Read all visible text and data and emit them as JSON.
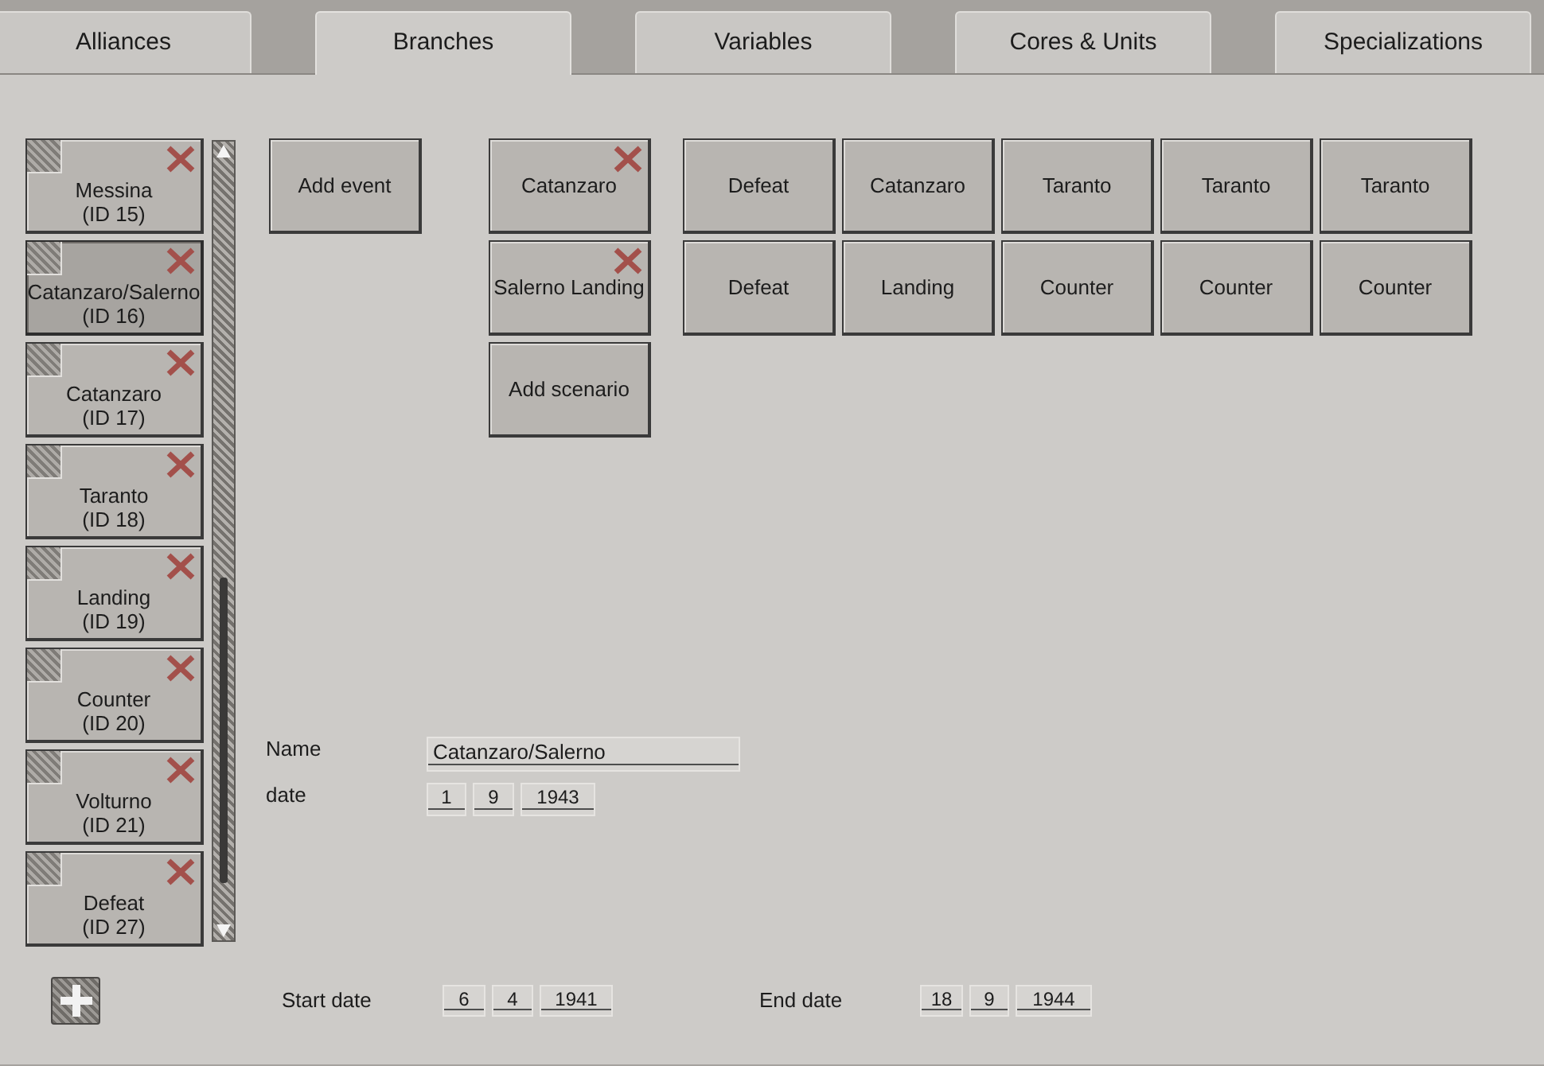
{
  "tabs": [
    {
      "label": "Alliances",
      "selected": false
    },
    {
      "label": "Branches",
      "selected": true
    },
    {
      "label": "Variables",
      "selected": false
    },
    {
      "label": "Cores & Units",
      "selected": false
    },
    {
      "label": "Specializations",
      "selected": false
    }
  ],
  "branch_list": {
    "items": [
      {
        "name": "Messina",
        "id": "(ID 15)",
        "selected": false
      },
      {
        "name": "Catanzaro/Salerno",
        "id": "(ID 16)",
        "selected": true
      },
      {
        "name": "Catanzaro",
        "id": "(ID 17)",
        "selected": false
      },
      {
        "name": "Taranto",
        "id": "(ID 18)",
        "selected": false
      },
      {
        "name": "Landing",
        "id": "(ID 19)",
        "selected": false
      },
      {
        "name": "Counter",
        "id": "(ID 20)",
        "selected": false
      },
      {
        "name": "Volturno",
        "id": "(ID 21)",
        "selected": false
      },
      {
        "name": "Defeat",
        "id": "(ID 27)",
        "selected": false
      }
    ]
  },
  "add_event_button": "Add event",
  "scenarios": [
    "Catanzaro",
    "Salerno Landing"
  ],
  "add_scenario_button": "Add scenario",
  "outcomes": [
    [
      "Defeat",
      "Catanzaro",
      "Taranto",
      "Taranto",
      "Taranto"
    ],
    [
      "Defeat",
      "Landing",
      "Counter",
      "Counter",
      "Counter"
    ]
  ],
  "branch_form": {
    "name_label": "Name",
    "name": "Catanzaro/Salerno",
    "date_label": "date",
    "date": [
      "1",
      "9",
      "1943"
    ]
  },
  "campaign": {
    "start_label": "Start date",
    "start_date": [
      "6",
      "4",
      "1941"
    ],
    "end_label": "End date",
    "end_date": [
      "18",
      "9",
      "1944"
    ]
  }
}
